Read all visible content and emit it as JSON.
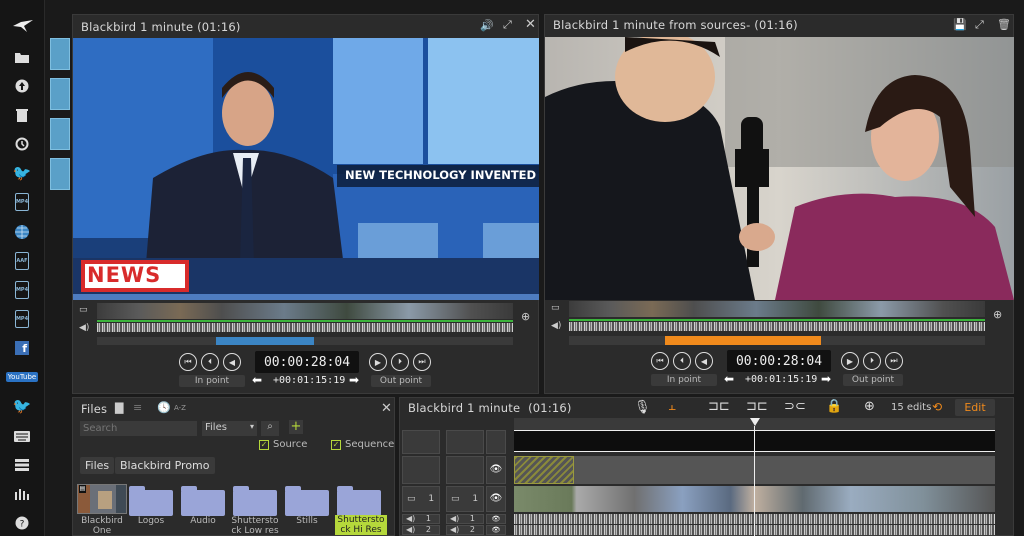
{
  "rail": {
    "items": [
      "bird-logo-icon",
      "folder-icon",
      "upload-icon",
      "trash-icon",
      "history-icon",
      "twitter-icon",
      "mp4-icon",
      "globe-icon",
      "aaf-icon",
      "mp4-icon",
      "mp4-icon",
      "facebook-icon",
      "youtube-icon",
      "twitter-icon",
      "keyboard-icon",
      "storyboard-icon",
      "chart-icon",
      "help-icon"
    ],
    "doc_labels": {
      "mp4": "MP4",
      "aaf": "AAF"
    },
    "youtube": "YouTube"
  },
  "left_viewer": {
    "title": "Blackbird 1 minute (01:16)",
    "timecode": "00:00:28:04",
    "duration": "+00:01:15:19",
    "in_label": "In point",
    "out_label": "Out point",
    "lower_third": "NEW TECHNOLOGY INVENTED",
    "news_badge": "NEWS"
  },
  "right_viewer": {
    "title": "Blackbird 1 minute from sources- (01:16)",
    "timecode": "00:00:28:04",
    "duration": "+00:01:15:19",
    "in_label": "In point",
    "out_label": "Out point"
  },
  "files": {
    "title": "Files",
    "sort": "A-Z",
    "search_placeholder": "Search",
    "filter_value": "Files",
    "source_label": "Source",
    "sequence_label": "Sequence",
    "breadcrumb": [
      "Files",
      "Blackbird Promo"
    ],
    "items": [
      "Blackbird One",
      "Logos",
      "Audio",
      "Shuttersto ck Low res",
      "Stills",
      "Shuttersto ck Hi Res"
    ]
  },
  "timeline": {
    "title": "Blackbird 1 minute",
    "duration": "(01:16)",
    "edits": "15 edits",
    "edit_button": "Edit",
    "track_numbers": [
      "1",
      "1",
      "1",
      "2",
      "1",
      "2"
    ]
  },
  "colors": {
    "accent": "#f08a1c",
    "blue": "#5aa0c8",
    "green": "#3bb33b"
  }
}
